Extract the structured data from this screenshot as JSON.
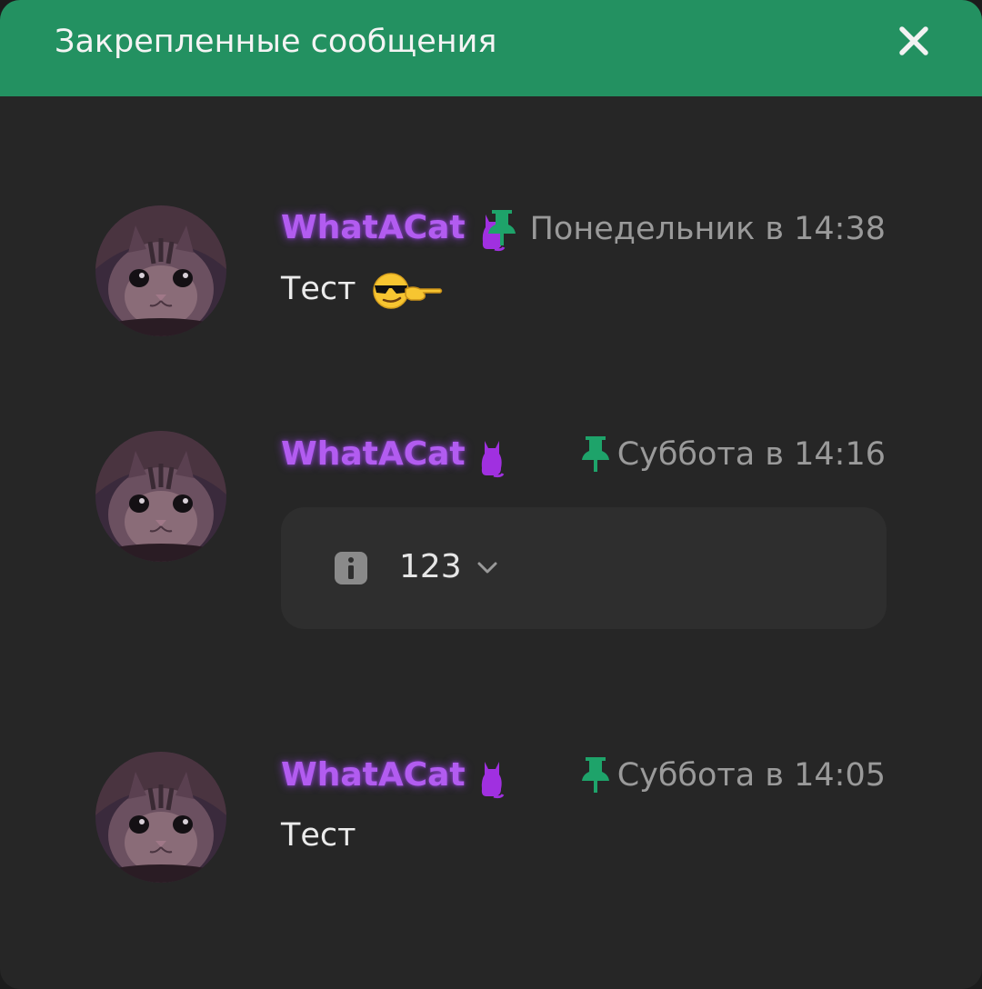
{
  "header": {
    "title": "Закрепленные сообщения",
    "close_icon": "close-icon",
    "background_color": "#239161"
  },
  "messages": [
    {
      "author": "WhatACat",
      "author_color": "#b25cf0",
      "badge_icon": "cat-icon",
      "pin_icon": "pin-icon",
      "time": "Понедельник в 14:38",
      "text": "Тест",
      "emoji": "cool-pointing-smiley"
    },
    {
      "author": "WhatACat",
      "badge_icon": "cat-icon",
      "pin_icon": "pin-icon",
      "time": "Суббота в 14:16",
      "poll": {
        "icon": "info-icon",
        "value": "123",
        "expand_icon": "chevron-down-icon"
      }
    },
    {
      "author": "WhatACat",
      "badge_icon": "cat-icon",
      "pin_icon": "pin-icon",
      "time": "Суббота в 14:05",
      "text": "Тест"
    }
  ]
}
